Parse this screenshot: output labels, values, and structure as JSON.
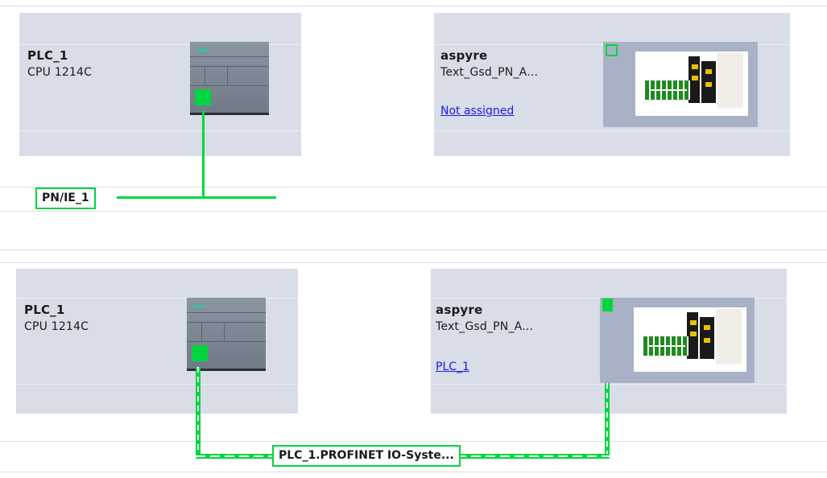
{
  "top": {
    "plc": {
      "name": "PLC_1",
      "type": "CPU 1214C"
    },
    "device": {
      "name": "aspyre",
      "type": "Text_Gsd_PN_A...",
      "link": "Not assigned"
    },
    "network_label": "PN/IE_1"
  },
  "bottom": {
    "plc": {
      "name": "PLC_1",
      "type": "CPU 1214C"
    },
    "device": {
      "name": "aspyre",
      "type": "Text_Gsd_PN_A...",
      "link": "PLC_1"
    },
    "io_system_label": "PLC_1.PROFINET IO-Syste..."
  },
  "colors": {
    "network": "#00d640",
    "device_bg": "#d8dde8",
    "link": "#1a1aee"
  },
  "icons": [
    "cpu-module-icon",
    "profinet-drive-icon",
    "ethernet-port-icon"
  ]
}
